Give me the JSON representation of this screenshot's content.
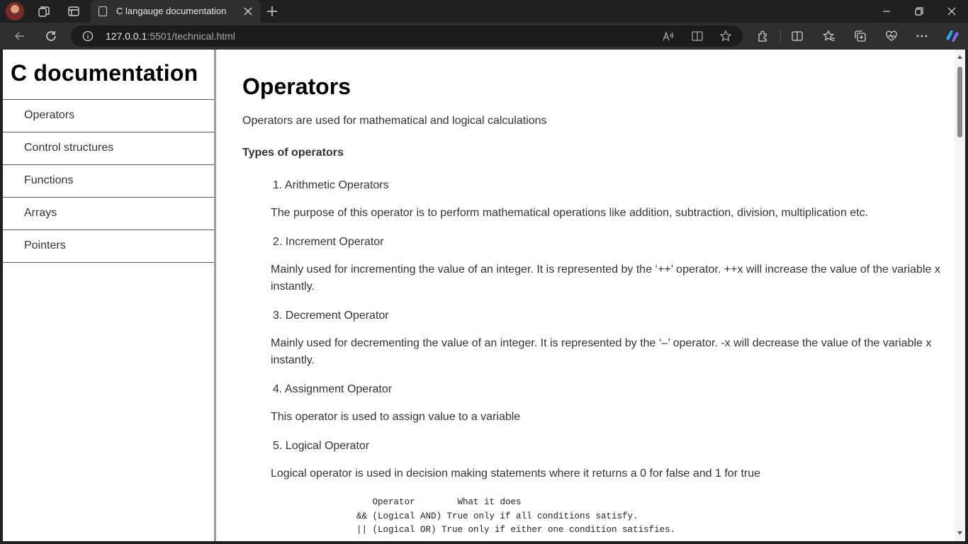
{
  "browser": {
    "tab_title": "C langauge documentation",
    "url_host": "127.0.0.1",
    "url_path": ":5501/technical.html"
  },
  "sidebar": {
    "title": "C documentation",
    "links": [
      "Operators",
      "Control structures",
      "Functions",
      "Arrays",
      "Pointers"
    ]
  },
  "main": {
    "heading": "Operators",
    "intro": "Operators are used for mathematical and logical calculations",
    "types_heading": "Types of operators",
    "items": [
      {
        "title": "1. Arithmetic Operators",
        "desc": "The purpose of this operator is to perform mathematical operations like addition, subtraction, division, multiplication etc."
      },
      {
        "title": "2. Increment Operator",
        "desc": "Mainly used for incrementing the value of an integer. It is represented by the ‘++’ operator. ++x will increase the value of the variable x instantly."
      },
      {
        "title": "3. Decrement Operator",
        "desc": "Mainly used for decrementing the value of an integer. It is represented by the ‘–’ operator. -x will decrease the value of the variable x instantly."
      },
      {
        "title": "4. Assignment Operator",
        "desc": "This operator is used to assign value to a variable"
      },
      {
        "title": "5. Logical Operator",
        "desc": "Logical operator is used in decision making statements where it returns a 0 for false and 1 for true"
      }
    ],
    "code_lines": [
      "   Operator        What it does",
      "&& (Logical AND) True only if all conditions satisfy.",
      "|| (Logical OR) True only if either one condition satisfies."
    ]
  }
}
